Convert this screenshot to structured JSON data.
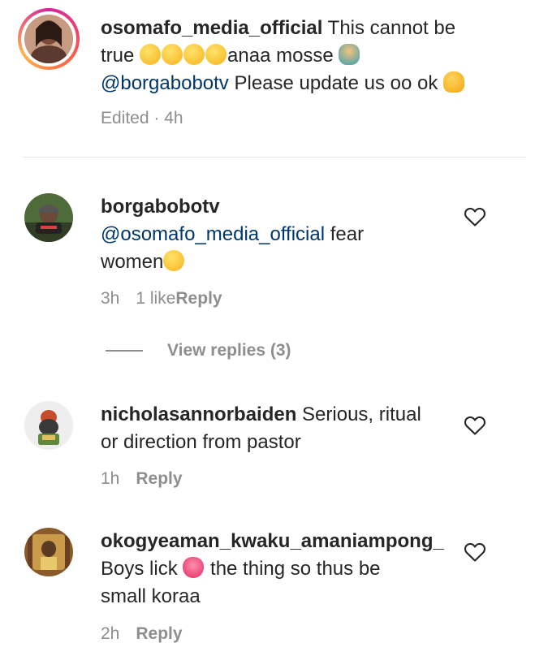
{
  "comments": [
    {
      "username": "osomafo_media_official",
      "text_1": " This cannot be",
      "text_2": "true ",
      "text_3": "anaa mosse ",
      "mention": "@borgabobotv",
      "text_4": " Please update us oo ok ",
      "edited": "Edited · 4h",
      "avatar_icon": "profile-photo"
    },
    {
      "username": "borgabobotv",
      "mention": "@osomafo_media_official",
      "text_1": " fear",
      "text_2": "women",
      "time": "3h",
      "likes": "1 like",
      "reply_label": "Reply",
      "view_replies": "View replies (3)",
      "avatar_icon": "profile-photo"
    },
    {
      "username": "nicholasannorbaiden",
      "text_1": " Serious, ritual",
      "text_2": "or direction from pastor",
      "time": "1h",
      "reply_label": "Reply",
      "avatar_icon": "profile-photo"
    },
    {
      "username": "okogyeaman_kwaku_amaniampong_",
      "text_1": "Boys lick ",
      "text_2": " the thing so thus be",
      "text_3": "small koraa",
      "time": "2h",
      "reply_label": "Reply",
      "avatar_icon": "profile-photo"
    }
  ],
  "icons": {
    "like": "heart-outline-icon"
  },
  "colors": {
    "mention": "#00376b",
    "meta": "#8e8e8e",
    "story_ring": "#d6249f"
  }
}
